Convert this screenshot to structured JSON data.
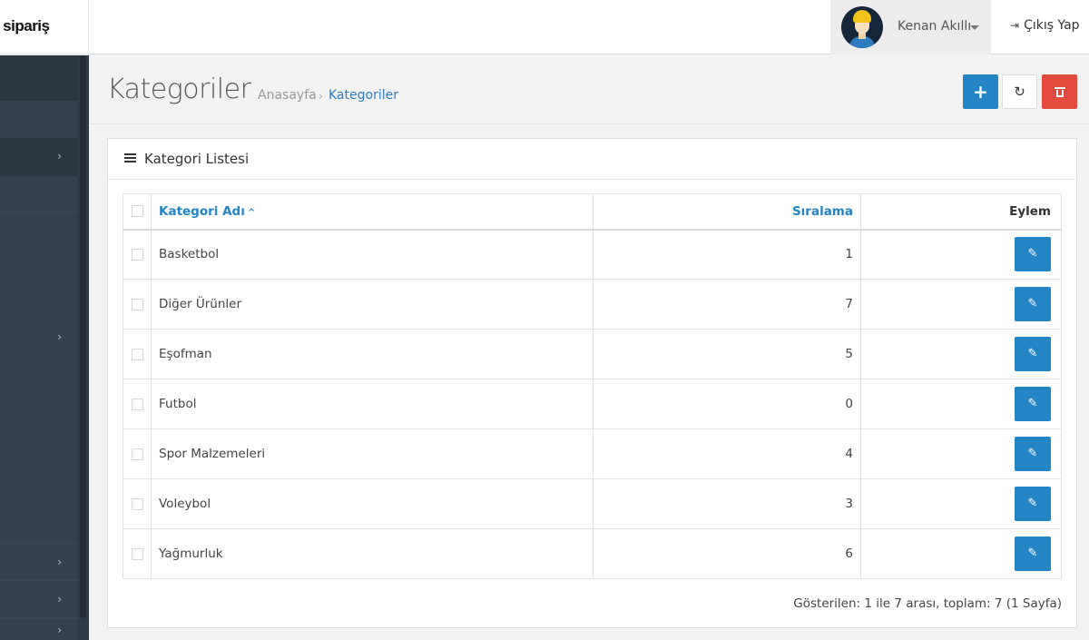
{
  "header": {
    "logo_text": "a sipariş",
    "user_name": "Kenan Akıllı",
    "logout_label": "Çıkış Yap"
  },
  "page": {
    "title": "Kategoriler",
    "breadcrumb": [
      "Anasayfa",
      "Kategoriler"
    ]
  },
  "panel": {
    "title": "Kategori Listesi",
    "columns": {
      "name": "Kategori Adı",
      "order": "Sıralama",
      "action": "Eylem"
    },
    "rows": [
      {
        "name": "Basketbol",
        "order": "1"
      },
      {
        "name": "Diğer Ürünler",
        "order": "7"
      },
      {
        "name": "Eşofman",
        "order": "5"
      },
      {
        "name": "Futbol",
        "order": "0"
      },
      {
        "name": "Spor Malzemeleri",
        "order": "4"
      },
      {
        "name": "Voleybol",
        "order": "3"
      },
      {
        "name": "Yağmurluk",
        "order": "6"
      }
    ],
    "footer_info": "Gösterilen: 1 ile 7 arası, toplam: 7 (1 Sayfa)"
  },
  "colors": {
    "primary": "#2384c6",
    "danger": "#e24a3d",
    "sidebar": "#364150",
    "sidebar_dark": "#2b3643"
  },
  "icons": {
    "add": "plus-icon",
    "refresh": "refresh-icon",
    "delete": "trash-icon",
    "edit": "pencil-icon",
    "panel": "list-icon",
    "logout": "sign-out-icon"
  }
}
